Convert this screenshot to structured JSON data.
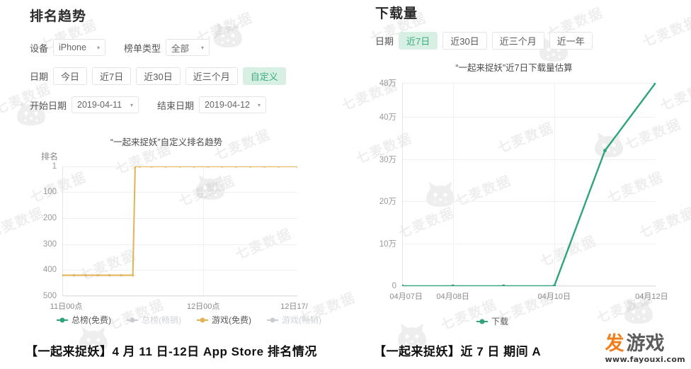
{
  "left": {
    "section_title": "排名趋势",
    "filters": {
      "device_label": "设备",
      "device_value": "iPhone",
      "list_type_label": "榜单类型",
      "list_type_value": "全部",
      "date_label": "日期",
      "date_options": [
        "今日",
        "近7日",
        "近30日",
        "近三个月",
        "自定义"
      ],
      "date_active": "自定义",
      "start_label": "开始日期",
      "start_value": "2019-04-11",
      "end_label": "结束日期",
      "end_value": "2019-04-12",
      "caret": "▾"
    },
    "caption": "【一起来捉妖】4 月 11 日-12日 App Store 排名情况"
  },
  "right": {
    "section_title": "下载量",
    "filters": {
      "date_label": "日期",
      "date_options": [
        "近7日",
        "近30日",
        "近三个月",
        "近一年"
      ],
      "date_active": "近7日"
    },
    "caption": "【一起来捉妖】近 7 日 期间 A"
  },
  "logo": {
    "brand_fa": "发",
    "brand_youxi": "游戏",
    "url": "www.fayouxi.com"
  },
  "watermark": {
    "text": "七麦数据"
  },
  "chart_data": [
    {
      "type": "line",
      "id": "rank-trend",
      "title": "“一起来捉妖”自定义排名趋势",
      "ylabel": "排名",
      "xlabel": "",
      "y_ticks": [
        "1",
        "100",
        "200",
        "300",
        "400",
        "500"
      ],
      "y_tick_values": [
        1,
        100,
        200,
        300,
        400,
        500
      ],
      "ylim": [
        1,
        500
      ],
      "y_inverted": true,
      "grid": true,
      "x_ticks": [
        "11日00点",
        "12日00点",
        "12日17/"
      ],
      "x_tick_positions": [
        0,
        0.6,
        1.0
      ],
      "legend_position": "bottom",
      "series": [
        {
          "name": "总榜(免费)",
          "color": "#2fa37a",
          "active": true,
          "values": []
        },
        {
          "name": "总榜(畅销)",
          "color": "#c9cdd2",
          "active": false,
          "values": []
        },
        {
          "name": "游戏(免费)",
          "color": "#e2b355",
          "active": true,
          "x": [
            0.0,
            0.05,
            0.1,
            0.15,
            0.2,
            0.25,
            0.3,
            0.31,
            0.33,
            0.38,
            0.44,
            0.5,
            0.56,
            0.62,
            0.68,
            0.74,
            0.8,
            0.86,
            0.92,
            1.0
          ],
          "values": [
            420,
            420,
            420,
            420,
            420,
            420,
            420,
            1,
            1,
            1,
            1,
            1,
            1,
            1,
            1,
            1,
            1,
            1,
            1,
            1
          ]
        },
        {
          "name": "游戏(畅销)",
          "color": "#c9cdd2",
          "active": false,
          "values": []
        }
      ]
    },
    {
      "type": "line",
      "id": "downloads",
      "title": "“一起来捉妖”近7日下载量估算",
      "ylabel": "",
      "xlabel": "",
      "y_ticks": [
        "48万",
        "40万",
        "30万",
        "20万",
        "10万",
        "0"
      ],
      "y_tick_values": [
        480000,
        400000,
        300000,
        200000,
        100000,
        0
      ],
      "ylim": [
        0,
        480000
      ],
      "grid": true,
      "x_ticks": [
        "04月07日",
        "04月08日",
        "04月10日",
        "04月12日"
      ],
      "x_tick_positions": [
        0.0,
        0.2,
        0.6,
        1.0
      ],
      "legend_position": "bottom",
      "series": [
        {
          "name": "下载",
          "color": "#2fa37a",
          "active": true,
          "x": [
            0.0,
            0.2,
            0.4,
            0.6,
            0.8,
            1.0
          ],
          "values": [
            0,
            0,
            0,
            0,
            320000,
            480000
          ]
        }
      ]
    }
  ]
}
